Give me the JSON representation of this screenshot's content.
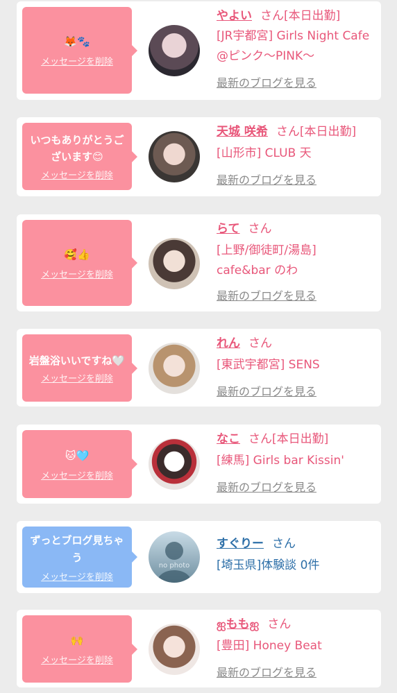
{
  "cards": [
    {
      "message": "🦊🐾",
      "delete_label": "メッセージを削除",
      "name": "やよい",
      "san": "さん",
      "status": "[本日出勤]",
      "shop": "[JR宇都宮] Girls Night Cafe @ピンク〜PINK〜",
      "blog_label": "最新のブログを見る"
    },
    {
      "message": "いつもありがとうございます😊",
      "delete_label": "メッセージを削除",
      "name": "天城 咲希",
      "san": "さん",
      "status": "[本日出勤]",
      "shop": "[山形市] CLUB 天",
      "blog_label": "最新のブログを見る"
    },
    {
      "message": "🥰👍",
      "delete_label": "メッセージを削除",
      "name": "らて",
      "san": "さん",
      "status": "",
      "shop": "[上野/御徒町/湯島] cafe&bar のわ",
      "blog_label": "最新のブログを見る"
    },
    {
      "message": "岩盤浴いいですね🤍",
      "delete_label": "メッセージを削除",
      "name": "れん",
      "san": "さん",
      "status": "",
      "shop": "[東武宇都宮] SENS",
      "blog_label": "最新のブログを見る"
    },
    {
      "message": "🐱🩵",
      "delete_label": "メッセージを削除",
      "name": "なこ",
      "san": "さん",
      "status": "[本日出勤]",
      "shop": "[練馬] Girls bar Kissin'",
      "blog_label": "最新のブログを見る"
    },
    {
      "message": "ずっとブログ見ちゃう",
      "delete_label": "メッセージを削除",
      "name": "すぐりー",
      "san": "さん",
      "status": "",
      "shop": "[埼玉県]体験談 0件",
      "avatar_text": "no photo"
    },
    {
      "message": "🙌",
      "delete_label": "メッセージを削除",
      "name": "ஐももஐ",
      "san": "さん",
      "status": "",
      "shop": "[豊田] Honey Beat",
      "blog_label": "最新のブログを見る"
    }
  ],
  "colors": {
    "pink_bubble": "#fb919f",
    "blue_bubble": "#8ab8f5",
    "pink_text": "#e8577a",
    "blue_text": "#2d6fa8",
    "page_bg": "#ececec"
  }
}
